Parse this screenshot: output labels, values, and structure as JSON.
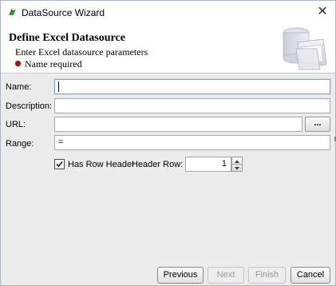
{
  "window": {
    "title": "DataSource Wizard"
  },
  "header": {
    "title": "Define Excel Datasource",
    "subtitle": "Enter Excel datasource parameters",
    "error": "Name required"
  },
  "form": {
    "name_label": "Name:",
    "name_value": "",
    "description_label": "Description:",
    "description_value": "",
    "url_label": "URL:",
    "url_value": "",
    "browse_label": "...",
    "range_label": "Range:",
    "range_value": "=",
    "has_row_header_label": "Has Row Header",
    "has_row_header_checked": true,
    "header_row_label": "Header Row:",
    "header_row_value": "1"
  },
  "footer": {
    "previous_label": "Previous",
    "next_label": "Next",
    "finish_label": "Finish",
    "cancel_label": "Cancel"
  },
  "colors": {
    "error_dot": "#d40000",
    "focus_border": "#7aa7d6"
  }
}
